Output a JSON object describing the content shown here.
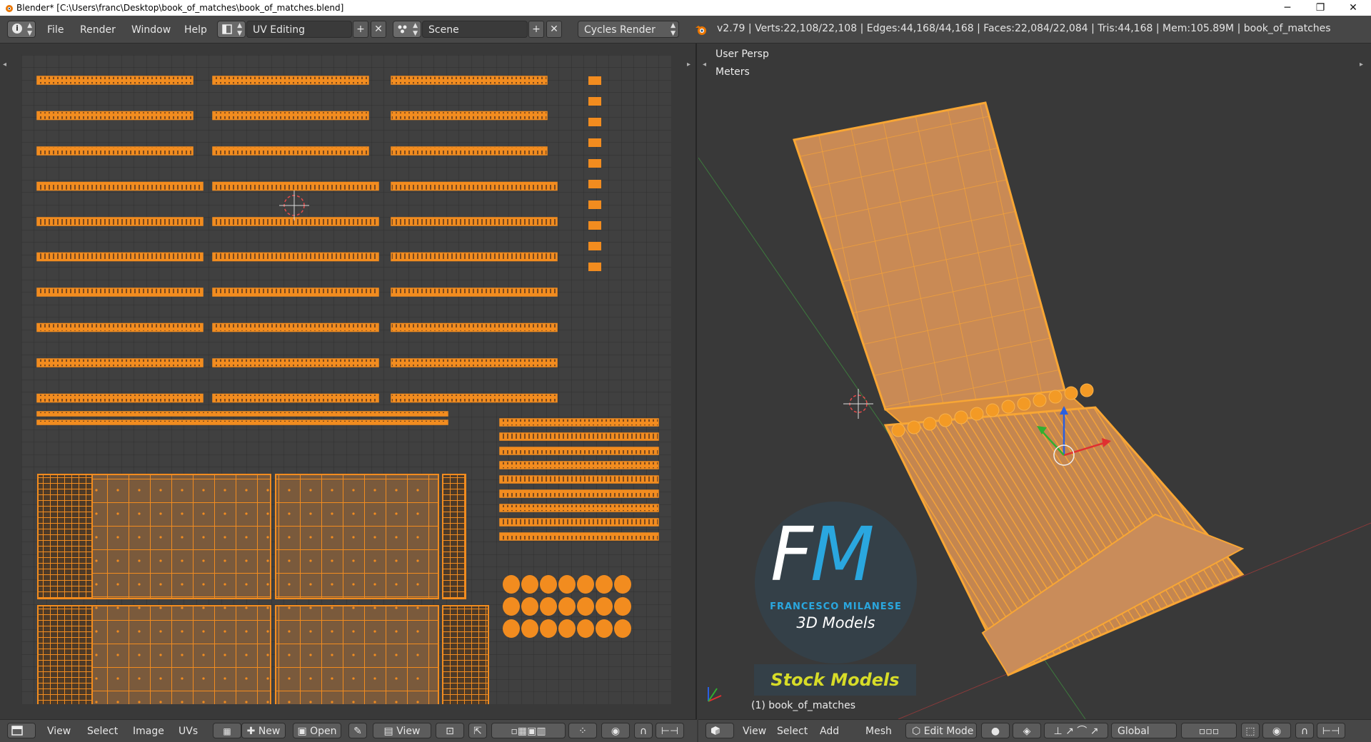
{
  "window": {
    "title": "Blender* [C:\\Users\\franc\\Desktop\\book_of_matches\\book_of_matches.blend]",
    "minimize": "─",
    "restore": "❐",
    "close": "✕"
  },
  "info_header": {
    "menus": [
      "File",
      "Render",
      "Window",
      "Help"
    ],
    "layout": "UV Editing",
    "scene": "Scene",
    "render_engine": "Cycles Render",
    "stats": "v2.79 | Verts:22,108/22,108 | Edges:44,168/44,168 | Faces:22,084/22,084 | Tris:44,168 | Mem:105.89M | book_of_matches",
    "add_glyph": "+",
    "remove_glyph": "✕"
  },
  "uv_editor": {
    "menus": [
      "View",
      "Select",
      "Image",
      "UVs"
    ],
    "new_label": "New",
    "open_label": "Open",
    "view_label": "View"
  },
  "viewport": {
    "view_name": "User Persp",
    "units": "Meters",
    "object_label": "(1) book_of_matches",
    "menus": [
      "View",
      "Select",
      "Add",
      "Mesh"
    ],
    "mode": "Edit Mode",
    "orientation": "Global"
  },
  "watermark": {
    "logo_letters": "FM",
    "author": "FRANCESCO MILANESE",
    "tagline": "3D Models",
    "badge": "Stock Models"
  },
  "colors": {
    "background": "#393939",
    "header": "#474747",
    "uv_orange": "#f28c1f",
    "mesh_face": "#c8864e",
    "logo_blue": "#2aa7df",
    "badge_yellow": "#d7dc28"
  }
}
